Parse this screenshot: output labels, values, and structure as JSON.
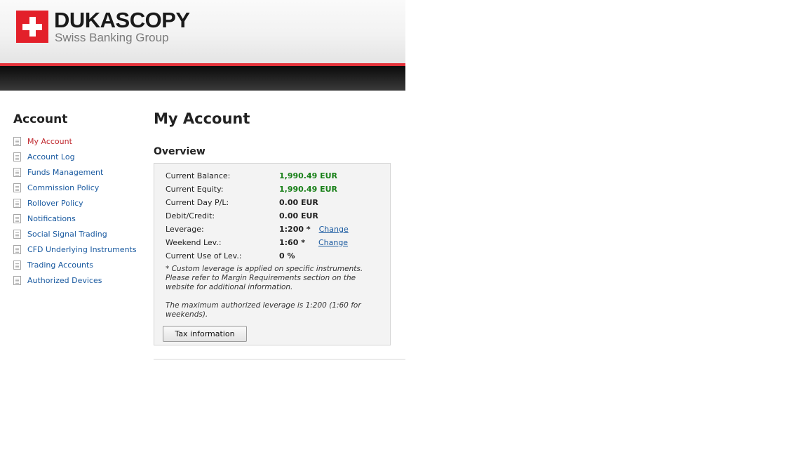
{
  "brand": {
    "name": "DUKASCOPY",
    "tagline": "Swiss Banking Group"
  },
  "sidebar": {
    "title": "Account",
    "items": [
      {
        "label": "My Account",
        "active": true
      },
      {
        "label": "Account Log"
      },
      {
        "label": "Funds Management"
      },
      {
        "label": "Commission Policy"
      },
      {
        "label": "Rollover Policy"
      },
      {
        "label": "Notifications"
      },
      {
        "label": "Social Signal Trading"
      },
      {
        "label": "CFD Underlying Instruments"
      },
      {
        "label": "Trading Accounts"
      },
      {
        "label": "Authorized Devices"
      }
    ]
  },
  "main": {
    "title": "My Account",
    "section": "Overview",
    "rows": [
      {
        "label": "Current Balance:",
        "value": "1,990.49 EUR"
      },
      {
        "label": "Current Equity:",
        "value": "1,990.49 EUR"
      },
      {
        "label": "Current Day P/L:",
        "value": "0.00 EUR"
      },
      {
        "label": "Debit/Credit:",
        "value": "0.00 EUR"
      },
      {
        "label": "Leverage:",
        "value": "1:200 *",
        "action": "Change"
      },
      {
        "label": "Weekend Lev.:",
        "value": "1:60 *",
        "action": "Change"
      },
      {
        "label": "Current Use of Lev.:",
        "value": "0 %"
      }
    ],
    "note1": "* Custom leverage is applied on specific instruments. Please refer to Margin Requirements section on the website for additional information.",
    "note2": "The maximum authorized leverage is 1:200 (1:60 for weekends).",
    "tax_button": "Tax information"
  },
  "colors": {
    "brand_red": "#e3202a",
    "link": "#1a5aa0",
    "active_link": "#c0272d",
    "positive": "#188018"
  }
}
